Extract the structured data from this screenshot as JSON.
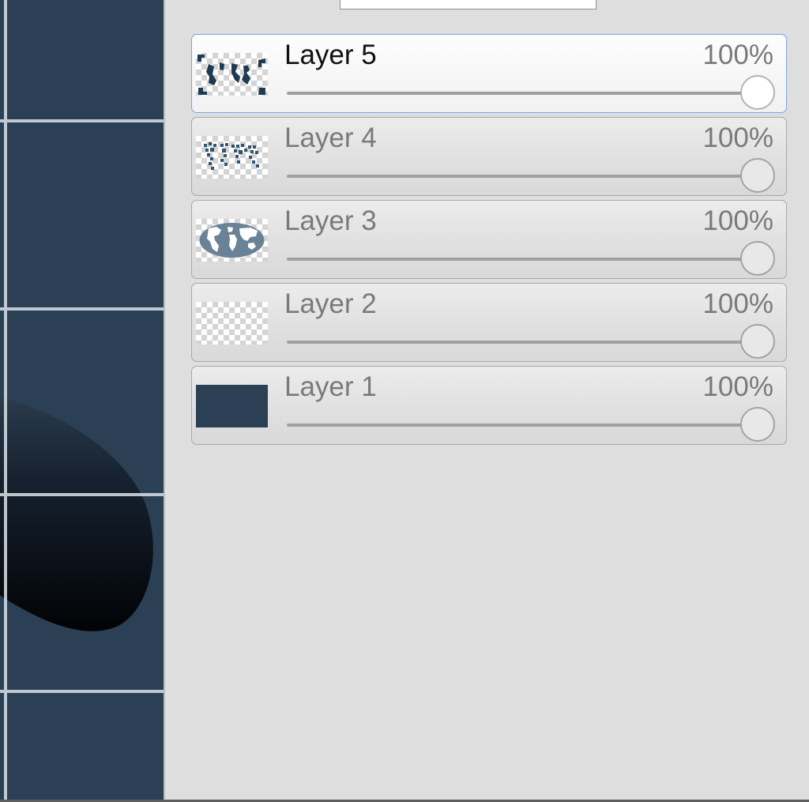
{
  "canvas": {
    "background_color": "#2b4054",
    "grid_line_color": "#dbe2e8"
  },
  "search": {
    "value": ""
  },
  "layers": [
    {
      "name": "Layer 5",
      "opacity_label": "100%",
      "opacity": 1.0,
      "selected": true,
      "thumbnail_icon": "map-fragments-thumbnail"
    },
    {
      "name": "Layer 4",
      "opacity_label": "100%",
      "opacity": 1.0,
      "selected": false,
      "thumbnail_icon": "dotted-map-thumbnail"
    },
    {
      "name": "Layer 3",
      "opacity_label": "100%",
      "opacity": 1.0,
      "selected": false,
      "thumbnail_icon": "world-map-thumbnail"
    },
    {
      "name": "Layer 2",
      "opacity_label": "100%",
      "opacity": 1.0,
      "selected": false,
      "thumbnail_icon": "transparent-thumbnail"
    },
    {
      "name": "Layer 1",
      "opacity_label": "100%",
      "opacity": 1.0,
      "selected": false,
      "thumbnail_icon": "solid-fill-thumbnail"
    }
  ],
  "colors": {
    "selected_border": "#7aa4ea",
    "thumbnail_fill": "#2b4054",
    "map_color": "#6a8296"
  }
}
